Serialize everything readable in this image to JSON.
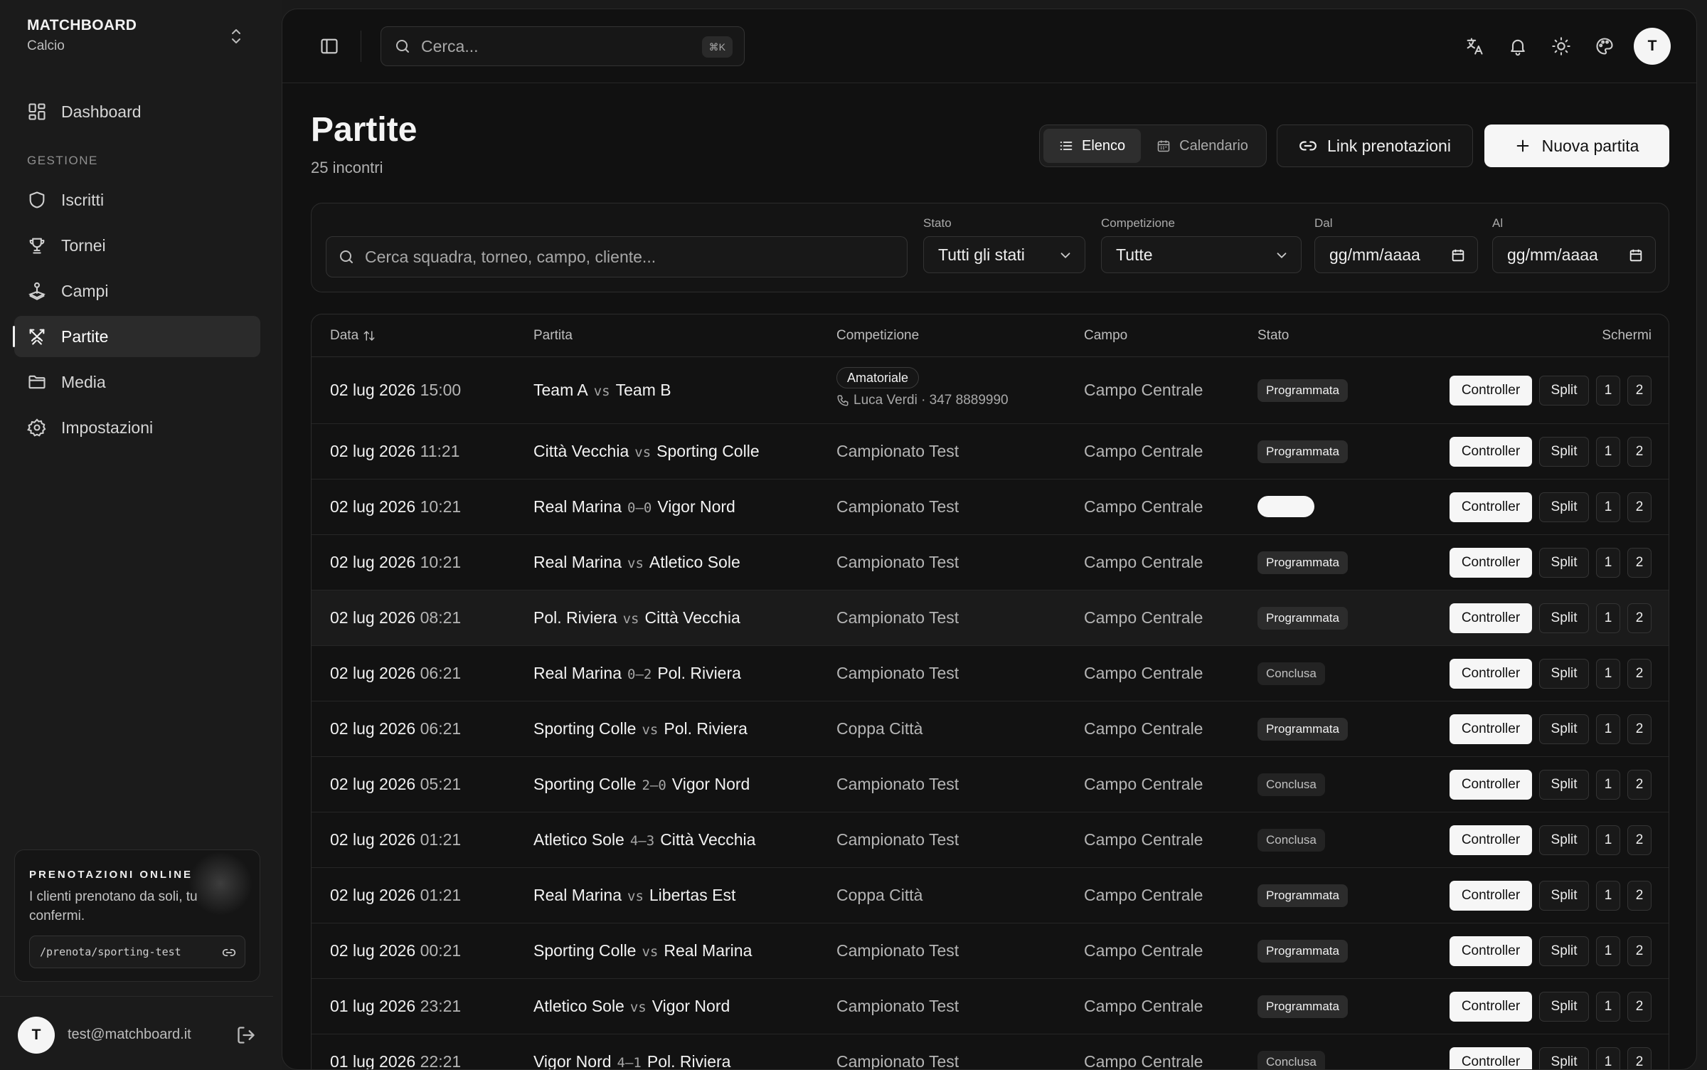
{
  "app": {
    "name": "MATCHBOARD",
    "sport": "Calcio"
  },
  "sidebar": {
    "dashboard": "Dashboard",
    "section": "GESTIONE",
    "items": [
      {
        "label": "Iscritti",
        "icon": "shield-icon"
      },
      {
        "label": "Tornei",
        "icon": "trophy-icon"
      },
      {
        "label": "Campi",
        "icon": "joystick-icon"
      },
      {
        "label": "Partite",
        "icon": "swords-icon",
        "active": true
      },
      {
        "label": "Media",
        "icon": "folder-icon"
      },
      {
        "label": "Impostazioni",
        "icon": "gear-icon"
      }
    ],
    "promo": {
      "title": "PRENOTAZIONI ONLINE",
      "text": "I clienti prenotano da soli, tu confermi.",
      "link": "/prenota/sporting-test"
    },
    "user": {
      "initial": "T",
      "email": "test@matchboard.it"
    }
  },
  "topbar": {
    "search_placeholder": "Cerca...",
    "shortcut": "⌘K",
    "avatar": "T"
  },
  "page": {
    "title": "Partite",
    "subtitle": "25 incontri",
    "view_list": "Elenco",
    "view_calendar": "Calendario",
    "link_button": "Link prenotazioni",
    "new_button": "Nuova partita"
  },
  "filters": {
    "search_placeholder": "Cerca squadra, torneo, campo, cliente...",
    "state_label": "Stato",
    "state_value": "Tutti gli stati",
    "competition_label": "Competizione",
    "competition_value": "Tutte",
    "from_label": "Dal",
    "from_value": "gg/mm/aaaa",
    "to_label": "Al",
    "to_value": "gg/mm/aaaa"
  },
  "table": {
    "headers": {
      "date": "Data",
      "match": "Partita",
      "competition": "Competizione",
      "field": "Campo",
      "state": "Stato",
      "screens": "Schermi"
    },
    "buttons": {
      "controller": "Controller",
      "split": "Split",
      "one": "1",
      "two": "2"
    },
    "rows": [
      {
        "date": "02 lug 2026",
        "time": "15:00",
        "home": "Team A",
        "mid": "vs",
        "away": "Team B",
        "competition": "Amatoriale",
        "contact": "Luca Verdi · 347 8889990",
        "field": "Campo Centrale",
        "state": "Programmata",
        "kind": "scheduled"
      },
      {
        "date": "02 lug 2026",
        "time": "11:21",
        "home": "Città Vecchia",
        "mid": "vs",
        "away": "Sporting Colle",
        "competition": "Campionato Test",
        "field": "Campo Centrale",
        "state": "Programmata",
        "kind": "scheduled"
      },
      {
        "date": "02 lug 2026",
        "time": "10:21",
        "home": "Real Marina",
        "mid": "0–0",
        "away": "Vigor Nord",
        "competition": "Campionato Test",
        "field": "Campo Centrale",
        "state": "",
        "kind": "live"
      },
      {
        "date": "02 lug 2026",
        "time": "10:21",
        "home": "Real Marina",
        "mid": "vs",
        "away": "Atletico Sole",
        "competition": "Campionato Test",
        "field": "Campo Centrale",
        "state": "Programmata",
        "kind": "scheduled"
      },
      {
        "date": "02 lug 2026",
        "time": "08:21",
        "home": "Pol. Riviera",
        "mid": "vs",
        "away": "Città Vecchia",
        "competition": "Campionato Test",
        "field": "Campo Centrale",
        "state": "Programmata",
        "kind": "scheduled"
      },
      {
        "date": "02 lug 2026",
        "time": "06:21",
        "home": "Real Marina",
        "mid": "0–2",
        "away": "Pol. Riviera",
        "competition": "Campionato Test",
        "field": "Campo Centrale",
        "state": "Conclusa",
        "kind": "done"
      },
      {
        "date": "02 lug 2026",
        "time": "06:21",
        "home": "Sporting Colle",
        "mid": "vs",
        "away": "Pol. Riviera",
        "competition": "Coppa Città",
        "field": "Campo Centrale",
        "state": "Programmata",
        "kind": "scheduled"
      },
      {
        "date": "02 lug 2026",
        "time": "05:21",
        "home": "Sporting Colle",
        "mid": "2–0",
        "away": "Vigor Nord",
        "competition": "Campionato Test",
        "field": "Campo Centrale",
        "state": "Conclusa",
        "kind": "done"
      },
      {
        "date": "02 lug 2026",
        "time": "01:21",
        "home": "Atletico Sole",
        "mid": "4–3",
        "away": "Città Vecchia",
        "competition": "Campionato Test",
        "field": "Campo Centrale",
        "state": "Conclusa",
        "kind": "done"
      },
      {
        "date": "02 lug 2026",
        "time": "01:21",
        "home": "Real Marina",
        "mid": "vs",
        "away": "Libertas Est",
        "competition": "Coppa Città",
        "field": "Campo Centrale",
        "state": "Programmata",
        "kind": "scheduled"
      },
      {
        "date": "02 lug 2026",
        "time": "00:21",
        "home": "Sporting Colle",
        "mid": "vs",
        "away": "Real Marina",
        "competition": "Campionato Test",
        "field": "Campo Centrale",
        "state": "Programmata",
        "kind": "scheduled"
      },
      {
        "date": "01 lug 2026",
        "time": "23:21",
        "home": "Atletico Sole",
        "mid": "vs",
        "away": "Vigor Nord",
        "competition": "Campionato Test",
        "field": "Campo Centrale",
        "state": "Programmata",
        "kind": "scheduled"
      },
      {
        "date": "01 lug 2026",
        "time": "22:21",
        "home": "Vigor Nord",
        "mid": "4–1",
        "away": "Pol. Riviera",
        "competition": "Campionato Test",
        "field": "Campo Centrale",
        "state": "Conclusa",
        "kind": "done"
      }
    ]
  }
}
